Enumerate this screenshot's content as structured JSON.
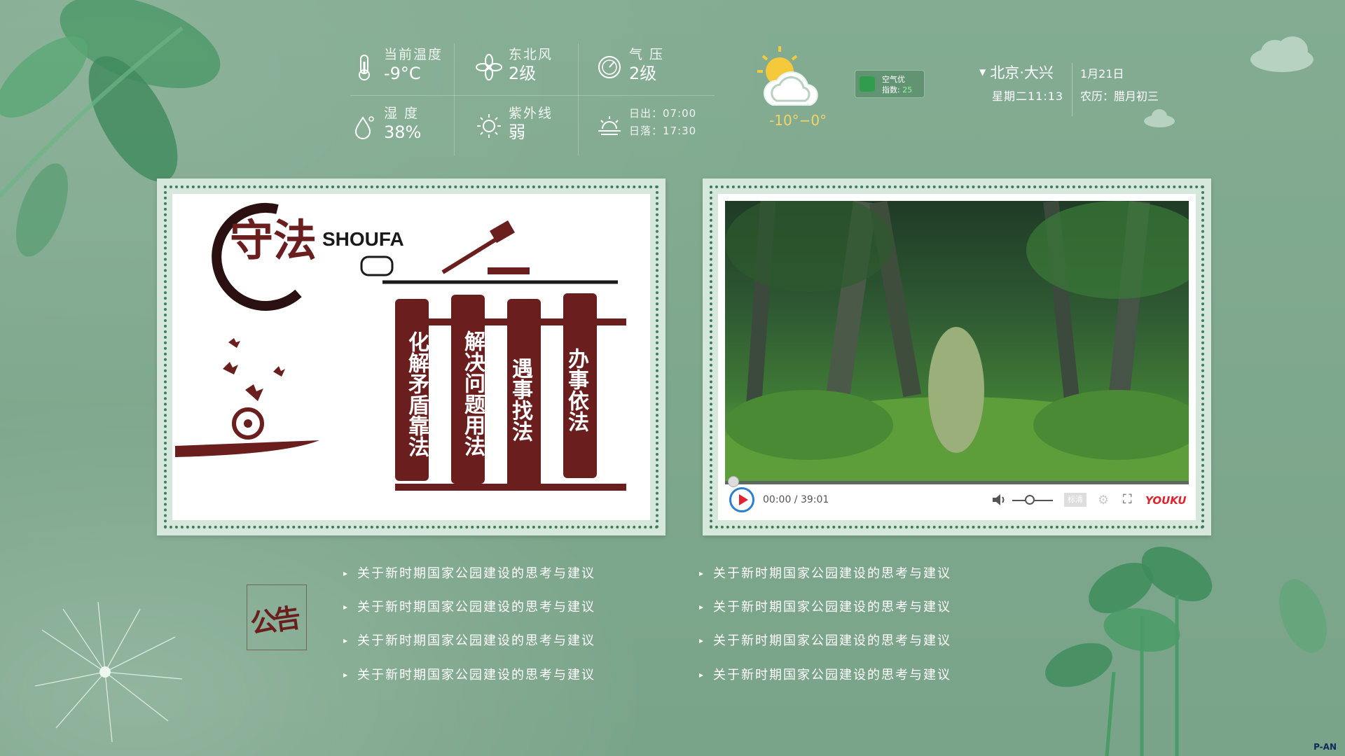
{
  "weather": {
    "temperature": {
      "label": "当前温度",
      "value": "-9°C",
      "icon": "thermometer-icon"
    },
    "wind": {
      "label": "东北风",
      "value": "2级",
      "icon": "fan-icon"
    },
    "pressure": {
      "label": "气 压",
      "value": "2级",
      "icon": "gauge-icon"
    },
    "humidity": {
      "label": "湿 度",
      "value": "38%",
      "icon": "droplet-icon"
    },
    "uv": {
      "label": "紫外线",
      "value": "弱",
      "icon": "sun-icon"
    },
    "sunrise": "日出：07:00",
    "sunset": "日落：17:30",
    "condition_icon": "partly-cloudy-icon",
    "temp_range": "-10°−0°"
  },
  "aqi": {
    "line1": "空气优",
    "label": "指数:",
    "value": "25"
  },
  "location": {
    "city": "北京·大兴",
    "date": "1月21日",
    "weekday_time": "星期二11:13",
    "lunar": "农历：腊月初三"
  },
  "banner": {
    "title_cn": "守法",
    "title_en": "SHOUFA",
    "columns": [
      "化解矛盾靠法",
      "解决问题用法",
      "遇事找法",
      "办事依法"
    ]
  },
  "video": {
    "time": "00:00 / 39:01",
    "quality": "标清",
    "brand": "YOUKU",
    "progress": 0
  },
  "notices": {
    "title": "公告",
    "left": [
      "关于新时期国家公园建设的思考与建议",
      "关于新时期国家公园建设的思考与建议",
      "关于新时期国家公园建设的思考与建议",
      "关于新时期国家公园建设的思考与建议"
    ],
    "right": [
      "关于新时期国家公园建设的思考与建议",
      "关于新时期国家公园建设的思考与建议",
      "关于新时期国家公园建设的思考与建议",
      "关于新时期国家公园建设的思考与建议"
    ]
  },
  "watermark": "P-AN",
  "colors": {
    "background": "#7fa88e",
    "accent_red": "#6b1e1e",
    "temp_range": "#f3d36a"
  }
}
